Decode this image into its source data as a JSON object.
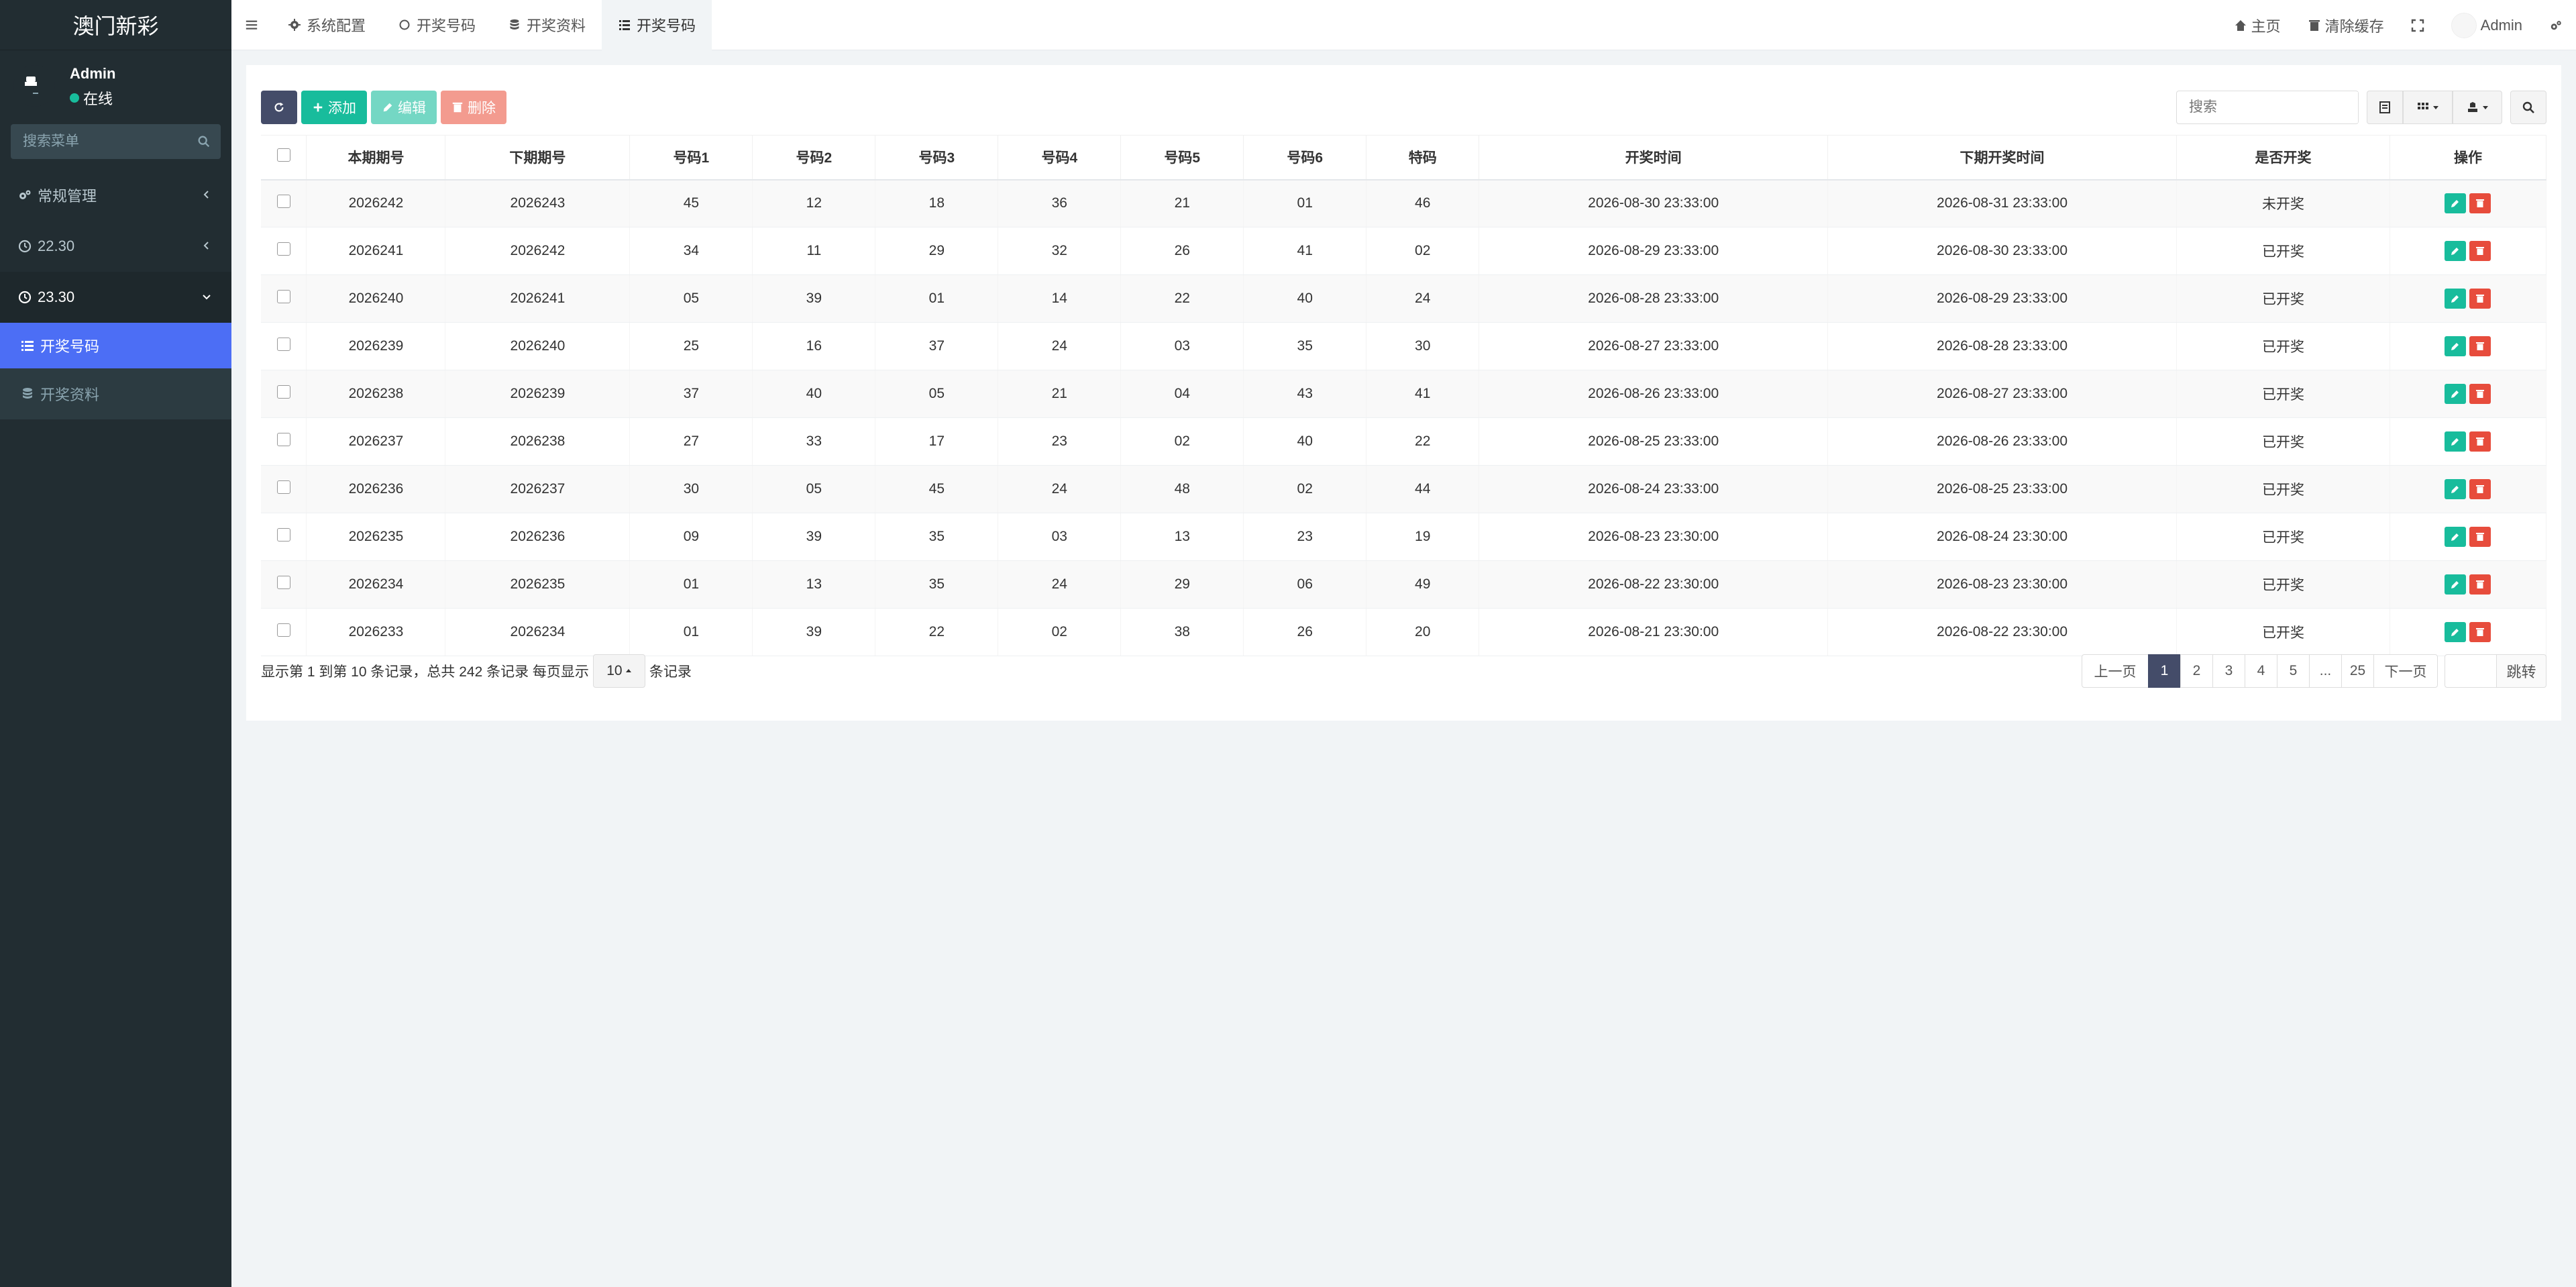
{
  "app": {
    "title": "澳门新彩"
  },
  "user": {
    "name": "Admin",
    "status": "在线"
  },
  "sidebar": {
    "search_placeholder": "搜索菜单",
    "items": [
      {
        "label": "常规管理",
        "icon": "cogs-icon"
      },
      {
        "label": "22.30",
        "icon": "clock-icon"
      },
      {
        "label": "23.30",
        "icon": "clock-icon"
      },
      {
        "label": "开奖号码",
        "icon": "list-icon",
        "active": true
      },
      {
        "label": "开奖资料",
        "icon": "database-icon"
      }
    ]
  },
  "topbar": {
    "tabs": [
      {
        "label": "系统配置",
        "icon": "gear-icon"
      },
      {
        "label": "开奖号码",
        "icon": "circle-icon"
      },
      {
        "label": "开奖资料",
        "icon": "database-icon"
      },
      {
        "label": "开奖号码",
        "icon": "list-icon",
        "active": true
      }
    ],
    "home": "主页",
    "clear_cache": "清除缓存",
    "user": "Admin"
  },
  "toolbar": {
    "add": "添加",
    "edit": "编辑",
    "delete": "删除",
    "search_placeholder": "搜索"
  },
  "table": {
    "headers": [
      "本期期号",
      "下期期号",
      "号码1",
      "号码2",
      "号码3",
      "号码4",
      "号码5",
      "号码6",
      "特码",
      "开奖时间",
      "下期开奖时间",
      "是否开奖",
      "操作"
    ],
    "rows": [
      [
        "2026242",
        "2026243",
        "45",
        "12",
        "18",
        "36",
        "21",
        "01",
        "46",
        "2026-08-30 23:33:00",
        "2026-08-31 23:33:00",
        "未开奖"
      ],
      [
        "2026241",
        "2026242",
        "34",
        "11",
        "29",
        "32",
        "26",
        "41",
        "02",
        "2026-08-29 23:33:00",
        "2026-08-30 23:33:00",
        "已开奖"
      ],
      [
        "2026240",
        "2026241",
        "05",
        "39",
        "01",
        "14",
        "22",
        "40",
        "24",
        "2026-08-28 23:33:00",
        "2026-08-29 23:33:00",
        "已开奖"
      ],
      [
        "2026239",
        "2026240",
        "25",
        "16",
        "37",
        "24",
        "03",
        "35",
        "30",
        "2026-08-27 23:33:00",
        "2026-08-28 23:33:00",
        "已开奖"
      ],
      [
        "2026238",
        "2026239",
        "37",
        "40",
        "05",
        "21",
        "04",
        "43",
        "41",
        "2026-08-26 23:33:00",
        "2026-08-27 23:33:00",
        "已开奖"
      ],
      [
        "2026237",
        "2026238",
        "27",
        "33",
        "17",
        "23",
        "02",
        "40",
        "22",
        "2026-08-25 23:33:00",
        "2026-08-26 23:33:00",
        "已开奖"
      ],
      [
        "2026236",
        "2026237",
        "30",
        "05",
        "45",
        "24",
        "48",
        "02",
        "44",
        "2026-08-24 23:33:00",
        "2026-08-25 23:33:00",
        "已开奖"
      ],
      [
        "2026235",
        "2026236",
        "09",
        "39",
        "35",
        "03",
        "13",
        "23",
        "19",
        "2026-08-23 23:30:00",
        "2026-08-24 23:30:00",
        "已开奖"
      ],
      [
        "2026234",
        "2026235",
        "01",
        "13",
        "35",
        "24",
        "29",
        "06",
        "49",
        "2026-08-22 23:30:00",
        "2026-08-23 23:30:00",
        "已开奖"
      ],
      [
        "2026233",
        "2026234",
        "01",
        "39",
        "22",
        "02",
        "38",
        "26",
        "20",
        "2026-08-21 23:30:00",
        "2026-08-22 23:30:00",
        "已开奖"
      ]
    ]
  },
  "pagination": {
    "summary_prefix": "显示第 1 到第 10 条记录，总共 242 条记录 每页显示",
    "page_size": "10",
    "summary_suffix": "条记录",
    "prev": "上一页",
    "pages": [
      "1",
      "2",
      "3",
      "4",
      "5",
      "...",
      "25"
    ],
    "current": "1",
    "next": "下一页",
    "jump": "跳转"
  },
  "colors": {
    "sidebar": "#222d32",
    "accent": "#4c6ef5",
    "success": "#18bc9c",
    "danger": "#e74c3c",
    "dark_button": "#444c69"
  }
}
